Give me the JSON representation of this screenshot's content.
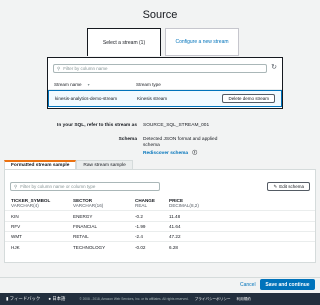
{
  "page": {
    "title": "Source"
  },
  "choices": {
    "selected": "Select a stream (1)",
    "alternate": "Configure a new stream"
  },
  "stream_picker": {
    "filter_placeholder": "Filter by column name",
    "columns": [
      "Stream name",
      "Stream type"
    ],
    "row": {
      "name": "kinesis-analytics-demo-stream",
      "type": "Kinesis stream"
    },
    "delete_label": "Delete demo stream"
  },
  "info": {
    "sql_label": "In your SQL, refer to this stream as",
    "sql_value": "SOURCE_SQL_STREAM_001",
    "schema_label": "Schema",
    "schema_value_1": "Detected JSON format and applied",
    "schema_value_2": "schema",
    "rediscover": "Rediscover schema",
    "info_icon": "info-icon"
  },
  "sample": {
    "tabs": [
      "Formatted stream sample",
      "Raw stream sample"
    ],
    "filter_placeholder": "Filter by column name or column type",
    "edit_label": "Edit schema",
    "headers": [
      {
        "name": "TICKER_SYMBOL",
        "type": "VARCHAR(4)"
      },
      {
        "name": "SECTOR",
        "type": "VARCHAR(16)"
      },
      {
        "name": "CHANGE",
        "type": "REAL"
      },
      {
        "name": "PRICE",
        "type": "DECIMAL(8,2)"
      }
    ],
    "rows": [
      [
        "KIN",
        "ENERGY",
        "-0.2",
        "11.48"
      ],
      [
        "RFV",
        "FINANCIAL",
        "-1.99",
        "41.64"
      ],
      [
        "WMT",
        "RETAIL",
        "-2.4",
        "47.22"
      ],
      [
        "HJK",
        "TECHNOLOGY",
        "-0.02",
        "6.28"
      ]
    ]
  },
  "actions": {
    "cancel": "Cancel",
    "primary": "Save and continue"
  },
  "footer": {
    "feedback": "フィードバック",
    "language": "日本語",
    "copyright": "© 2008 - 2018, Amazon Web Services, Inc. or its affiliates. All rights reserved.",
    "privacy": "プライバシーポリシー",
    "terms": "利用規約"
  }
}
